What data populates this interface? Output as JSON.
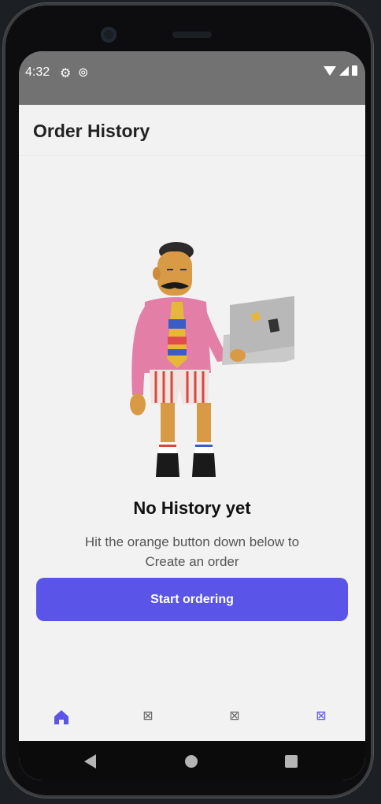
{
  "status_bar": {
    "time": "4:32"
  },
  "app_bar": {
    "title": "Order History"
  },
  "empty_state": {
    "title": "No History yet",
    "message": "Hit the orange button down below to Create an order"
  },
  "actions": {
    "start_label": "Start ordering"
  },
  "bottom_nav": {
    "items": [
      {
        "icon": "home-icon",
        "active": true
      },
      {
        "icon": "broken-icon",
        "active": false
      },
      {
        "icon": "broken-icon",
        "active": false
      },
      {
        "icon": "broken-icon",
        "active": true
      }
    ]
  },
  "colors": {
    "accent": "#5a55e8",
    "status_bar": "#727272",
    "background": "#f2f2f2"
  }
}
